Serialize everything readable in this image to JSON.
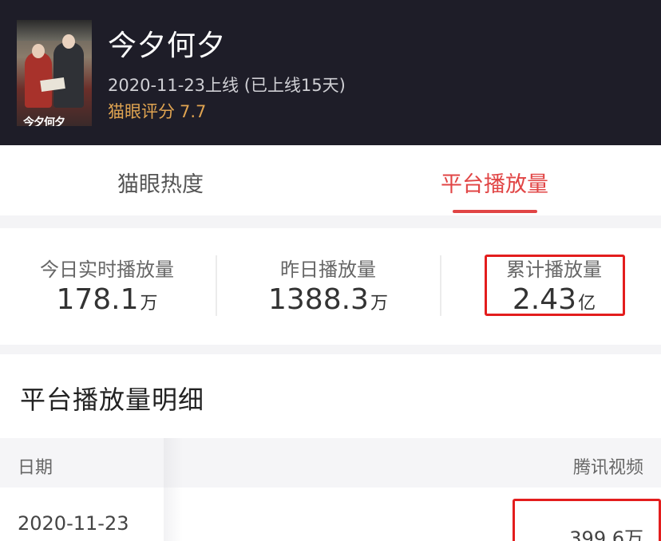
{
  "header": {
    "poster_title": "今夕何夕",
    "title": "今夕何夕",
    "release": "2020-11-23上线 (已上线15天)",
    "rating_label": "猫眼评分",
    "rating_value": "7.7"
  },
  "tabs": [
    {
      "label": "猫眼热度",
      "active": false
    },
    {
      "label": "平台播放量",
      "active": true
    }
  ],
  "stats": [
    {
      "label": "今日实时播放量",
      "value": "178.1",
      "unit": "万"
    },
    {
      "label": "昨日播放量",
      "value": "1388.3",
      "unit": "万"
    },
    {
      "label": "累计播放量",
      "value": "2.43",
      "unit": "亿"
    }
  ],
  "detail": {
    "title": "平台播放量明细",
    "columns": [
      "日期",
      "腾讯视频"
    ],
    "rows": [
      {
        "date": "2020-11-23",
        "value": "399.6万"
      }
    ]
  },
  "colors": {
    "header_bg": "#1e1d28",
    "accent": "#e14545",
    "rating": "#e0a451",
    "highlight_box": "#e31d1d"
  }
}
